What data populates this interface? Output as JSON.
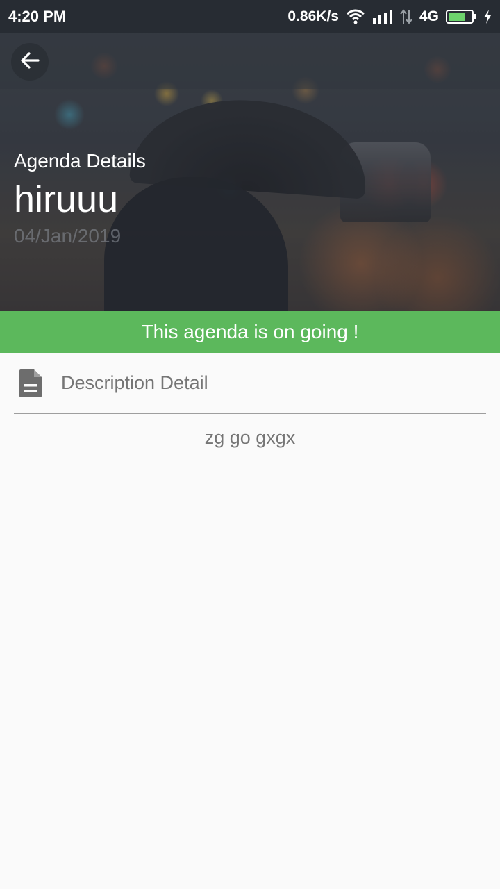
{
  "status_bar": {
    "time": "4:20 PM",
    "network_speed": "0.86K/s",
    "network_type": "4G",
    "icons": [
      "wifi-icon",
      "signal-icon",
      "data-arrows-icon",
      "battery-icon",
      "charging-icon"
    ]
  },
  "toolbar": {
    "back_icon": "arrow-back-icon"
  },
  "hero": {
    "subtitle": "Agenda Details",
    "title": "hiruuu",
    "date": "04/Jan/2019"
  },
  "banner": {
    "text": "This agenda is on going !",
    "color": "#5cb85c"
  },
  "description": {
    "icon": "document-icon",
    "label": "Description Detail",
    "body": "zg go gxgx"
  },
  "colors": {
    "accent_green": "#5cb85c",
    "text_gray": "#757575",
    "background": "#fafafa"
  }
}
